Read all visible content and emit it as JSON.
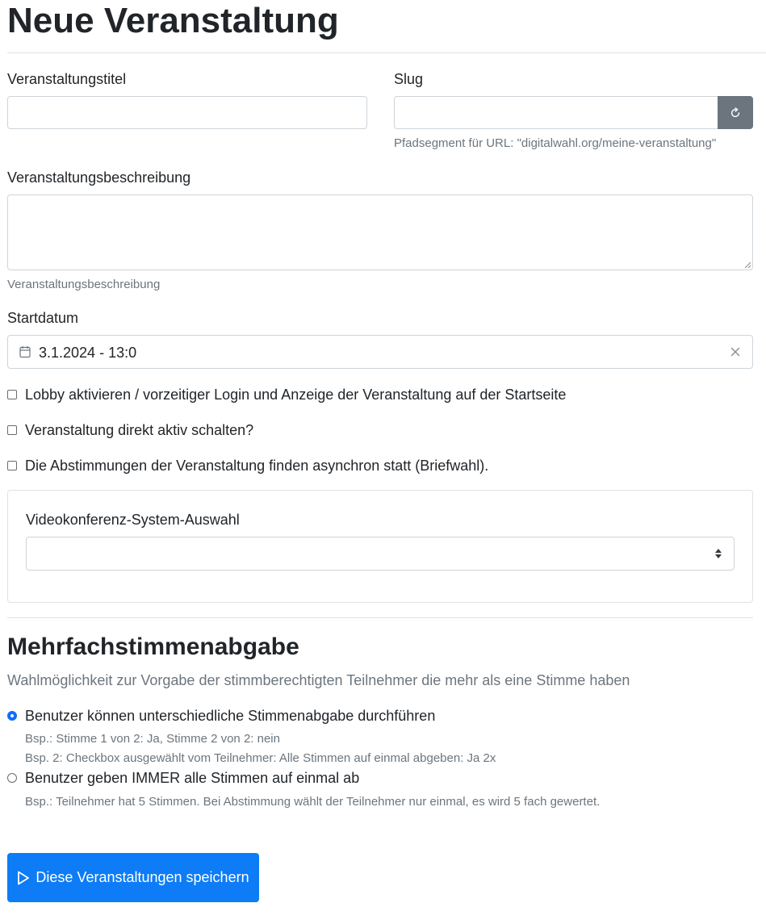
{
  "page": {
    "title": "Neue Veranstaltung"
  },
  "form": {
    "title_label": "Veranstaltungstitel",
    "title_value": "",
    "slug_label": "Slug",
    "slug_value": "",
    "slug_help": "Pfadsegment für URL: \"digitalwahl.org/meine-veranstaltung\"",
    "description_label": "Veranstaltungsbeschreibung",
    "description_value": "",
    "description_help": "Veranstaltungsbeschreibung",
    "start_label": "Startdatum",
    "start_value": "3.1.2024 - 13:0",
    "checkboxes": [
      {
        "label": "Lobby aktivieren / vorzeitiger Login und Anzeige der Veranstaltung auf der Startseite",
        "checked": false
      },
      {
        "label": "Veranstaltung direkt aktiv schalten?",
        "checked": false
      },
      {
        "label": "Die Abstimmungen der Veranstaltung finden asynchron statt (Briefwahl).",
        "checked": false
      }
    ],
    "video_label": "Videokonferenz-System-Auswahl",
    "video_value": ""
  },
  "multivote": {
    "heading": "Mehrfachstimmenabgabe",
    "lead": "Wahlmöglichkeit zur Vorgabe der stimmberechtigten Teilnehmer die mehr als eine Stimme haben",
    "options": [
      {
        "label": "Benutzer können unterschiedliche Stimmenabgabe durchführen",
        "selected": true,
        "help": [
          "Bsp.: Stimme 1 von 2: Ja, Stimme 2 von 2: nein",
          "Bsp. 2: Checkbox ausgewählt vom Teilnehmer: Alle Stimmen auf einmal abgeben: Ja 2x"
        ]
      },
      {
        "label": "Benutzer geben IMMER alle Stimmen auf einmal ab",
        "selected": false,
        "help": [
          "Bsp.: Teilnehmer hat 5 Stimmen. Bei Abstimmung wählt der Teilnehmer nur einmal, es wird 5 fach gewertet."
        ]
      }
    ]
  },
  "actions": {
    "save_label": "Diese Veranstaltungen speichern"
  },
  "icons": {
    "refresh": "refresh-icon",
    "calendar": "calendar-icon",
    "clear": "close-icon",
    "select_arrows": "sort-arrows-icon",
    "play": "play-icon"
  },
  "colors": {
    "primary": "#0d7cf6",
    "secondary": "#6c757d",
    "border": "#ced4da"
  }
}
